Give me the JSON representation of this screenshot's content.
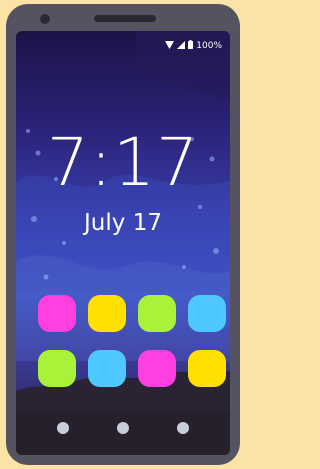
{
  "status_bar": {
    "wifi_icon": "wifi-icon",
    "signal_icon": "cell-signal-icon",
    "battery_icon": "battery-icon",
    "battery_level": "100%"
  },
  "lock_screen": {
    "time": "7:17",
    "date": "July 17"
  },
  "apps": [
    {
      "name": "app-1",
      "color": "#ff3fe0"
    },
    {
      "name": "app-2",
      "color": "#ffe000"
    },
    {
      "name": "app-3",
      "color": "#a9f23a"
    },
    {
      "name": "app-4",
      "color": "#4fc8ff"
    },
    {
      "name": "app-5",
      "color": "#a9f23a"
    },
    {
      "name": "app-6",
      "color": "#4fc8ff"
    },
    {
      "name": "app-7",
      "color": "#ff3fe0"
    },
    {
      "name": "app-8",
      "color": "#ffe000"
    }
  ],
  "nav_buttons": [
    "back-button",
    "home-button",
    "recents-button"
  ],
  "colors": {
    "background": "#fbe3a6",
    "phone_body": "#55535f",
    "nav_bar": "#25202c"
  }
}
